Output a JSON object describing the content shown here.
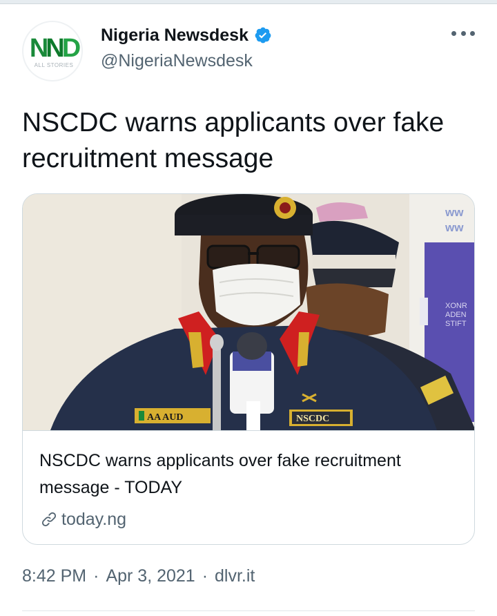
{
  "author": {
    "display_name": "Nigeria Newsdesk",
    "handle": "@NigeriaNewsdesk",
    "avatar_logo": "NND",
    "avatar_subtext": "ALL STORIES",
    "verified_icon": "verified-badge-icon"
  },
  "tweet": {
    "text": "NSCDC warns applicants over fake recruitment message"
  },
  "card": {
    "image_alt": "NSCDC officer in beret and face mask speaking at microphones",
    "image_texts": {
      "name_tag": "AA AUD",
      "badge": "NSCDC",
      "backdrop": "ww\nww",
      "banner": "XONR\nADEN\nSTIFT"
    },
    "title": "NSCDC warns applicants over fake recruitment message - TODAY",
    "domain": "today.ng"
  },
  "meta": {
    "time": "8:42 PM",
    "date": "Apr 3, 2021",
    "source": "dlvr.it",
    "separator": "·"
  },
  "colors": {
    "text_primary": "#0f1419",
    "text_secondary": "#536471",
    "verified": "#1d9bf0",
    "border": "#cfd9de",
    "logo_green": "#1a8a3a"
  }
}
